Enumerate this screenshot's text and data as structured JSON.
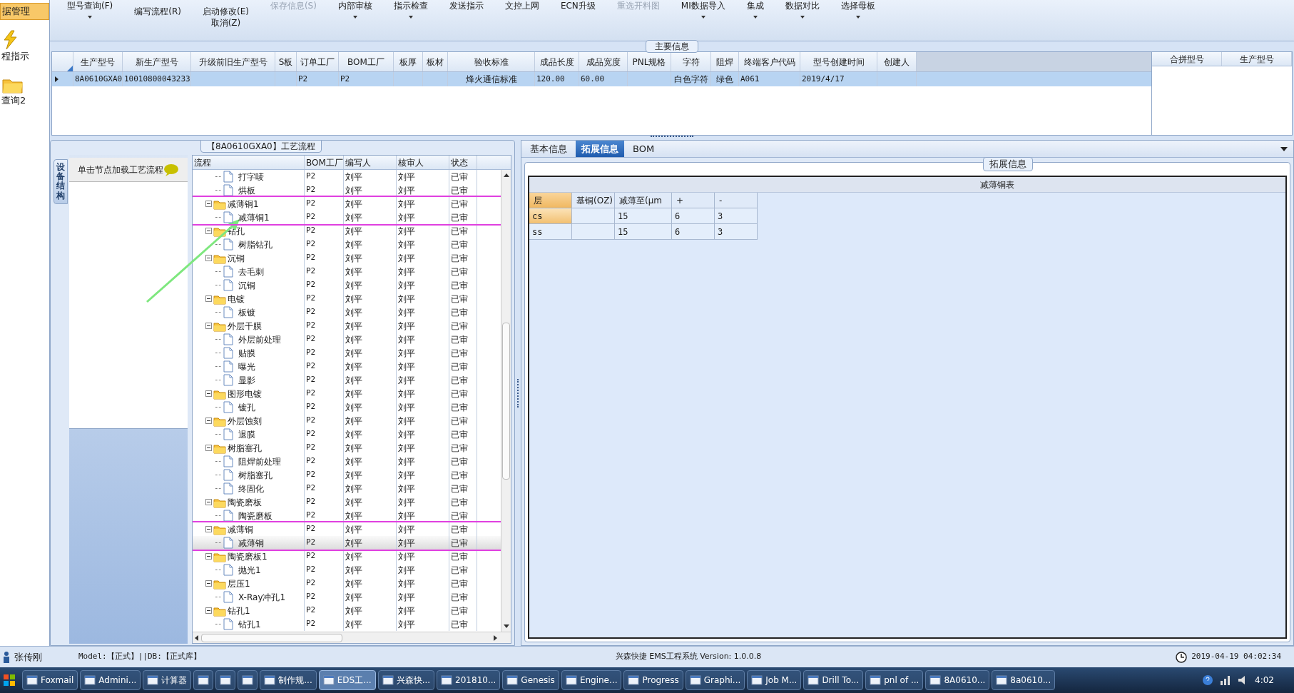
{
  "sidebar": {
    "items": [
      {
        "label": "据管理",
        "selected": true
      },
      {
        "label": "程指示",
        "selected": false
      },
      {
        "label": "查询2",
        "selected": false
      }
    ]
  },
  "toolbar": [
    {
      "lines": [
        "型号查询(F)"
      ],
      "disabled": false,
      "dropdown": true
    },
    {
      "lines": [
        "编写流程(R)"
      ],
      "disabled": false,
      "dropdown": false
    },
    {
      "lines": [
        "启动修改(E)",
        "取消(Z)"
      ],
      "disabled": false,
      "dropdown": false
    },
    {
      "lines": [
        "保存信息(S)"
      ],
      "disabled": true,
      "dropdown": false
    },
    {
      "lines": [
        "内部审核"
      ],
      "disabled": false,
      "dropdown": true
    },
    {
      "lines": [
        "指示检查"
      ],
      "disabled": false,
      "dropdown": true
    },
    {
      "lines": [
        "发送指示"
      ],
      "disabled": false,
      "dropdown": false
    },
    {
      "lines": [
        "文控上网"
      ],
      "disabled": false,
      "dropdown": false
    },
    {
      "lines": [
        "ECN升级"
      ],
      "disabled": false,
      "dropdown": false
    },
    {
      "lines": [
        "重选开料图"
      ],
      "disabled": true,
      "dropdown": false
    },
    {
      "lines": [
        "MI数据导入"
      ],
      "disabled": false,
      "dropdown": true
    },
    {
      "lines": [
        "集成"
      ],
      "disabled": false,
      "dropdown": true
    },
    {
      "lines": [
        "数据对比"
      ],
      "disabled": false,
      "dropdown": true
    },
    {
      "lines": [
        "选择母板"
      ],
      "disabled": false,
      "dropdown": true
    }
  ],
  "main_info": {
    "title": "主要信息",
    "columns": [
      "生产型号",
      "新生产型号",
      "升级前旧生产型号",
      "S板",
      "订单工厂",
      "BOM工厂",
      "板厚",
      "板材",
      "验收标准",
      "成品长度",
      "成品宽度",
      "PNL规格",
      "字符",
      "阻焊",
      "终端客户代码",
      "型号创建时间",
      "创建人"
    ],
    "rows": [
      {
        "selected": true,
        "cells": [
          "8A0610GXA0",
          "10010800043233",
          null,
          null,
          "P2",
          "P2",
          null,
          null,
          "烽火通信标准",
          "120.00",
          "60.00",
          null,
          "白色字符",
          "绿色",
          "A061",
          "2019/4/17",
          null
        ]
      }
    ],
    "side_columns": [
      "合拼型号",
      "生产型号"
    ]
  },
  "process": {
    "title": "【8A0610GXA0】工艺流程",
    "side_tab": "设备结构",
    "hint": "单击节点加载工艺流程",
    "columns": [
      "流程",
      "BOM工厂",
      "编写人",
      "核审人",
      "状态"
    ],
    "items": [
      {
        "kind": "file",
        "label": "打字唛",
        "cells": [
          "P2",
          "刘平",
          "刘平",
          "已审"
        ],
        "selected": false
      },
      {
        "kind": "file",
        "label": "烘板",
        "cells": [
          "P2",
          "刘平",
          "刘平",
          "已审"
        ],
        "selected": false
      },
      {
        "kind": "folder",
        "label": "减薄铜1",
        "cells": [
          "P2",
          "刘平",
          "刘平",
          "已审"
        ],
        "selected": false,
        "expanded": true,
        "highlighted": true,
        "children": [
          {
            "kind": "file",
            "label": "减薄铜1",
            "cells": [
              "P2",
              "刘平",
              "刘平",
              "已审"
            ],
            "selected": false
          }
        ]
      },
      {
        "kind": "folder",
        "label": "钻孔",
        "cells": [
          "P2",
          "刘平",
          "刘平",
          "已审"
        ],
        "selected": false,
        "expanded": true,
        "highlighted": false,
        "children": [
          {
            "kind": "file",
            "label": "树脂钻孔",
            "cells": [
              "P2",
              "刘平",
              "刘平",
              "已审"
            ],
            "selected": false
          }
        ]
      },
      {
        "kind": "folder",
        "label": "沉铜",
        "cells": [
          "P2",
          "刘平",
          "刘平",
          "已审"
        ],
        "selected": false,
        "expanded": true,
        "highlighted": false,
        "children": [
          {
            "kind": "file",
            "label": "去毛刺",
            "cells": [
              "P2",
              "刘平",
              "刘平",
              "已审"
            ],
            "selected": false
          },
          {
            "kind": "file",
            "label": "沉铜",
            "cells": [
              "P2",
              "刘平",
              "刘平",
              "已审"
            ],
            "selected": false
          }
        ]
      },
      {
        "kind": "folder",
        "label": "电镀",
        "cells": [
          "P2",
          "刘平",
          "刘平",
          "已审"
        ],
        "selected": false,
        "expanded": true,
        "highlighted": false,
        "children": [
          {
            "kind": "file",
            "label": "板镀",
            "cells": [
              "P2",
              "刘平",
              "刘平",
              "已审"
            ],
            "selected": false
          }
        ]
      },
      {
        "kind": "folder",
        "label": "外层干膜",
        "cells": [
          "P2",
          "刘平",
          "刘平",
          "已审"
        ],
        "selected": false,
        "expanded": true,
        "highlighted": false,
        "children": [
          {
            "kind": "file",
            "label": "外层前处理",
            "cells": [
              "P2",
              "刘平",
              "刘平",
              "已审"
            ],
            "selected": false
          },
          {
            "kind": "file",
            "label": "贴膜",
            "cells": [
              "P2",
              "刘平",
              "刘平",
              "已审"
            ],
            "selected": false
          },
          {
            "kind": "file",
            "label": "曝光",
            "cells": [
              "P2",
              "刘平",
              "刘平",
              "已审"
            ],
            "selected": false
          },
          {
            "kind": "file",
            "label": "显影",
            "cells": [
              "P2",
              "刘平",
              "刘平",
              "已审"
            ],
            "selected": false
          }
        ]
      },
      {
        "kind": "folder",
        "label": "图形电镀",
        "cells": [
          "P2",
          "刘平",
          "刘平",
          "已审"
        ],
        "selected": false,
        "expanded": true,
        "highlighted": false,
        "children": [
          {
            "kind": "file",
            "label": "镀孔",
            "cells": [
              "P2",
              "刘平",
              "刘平",
              "已审"
            ],
            "selected": false
          }
        ]
      },
      {
        "kind": "folder",
        "label": "外层蚀刻",
        "cells": [
          "P2",
          "刘平",
          "刘平",
          "已审"
        ],
        "selected": false,
        "expanded": true,
        "highlighted": false,
        "children": [
          {
            "kind": "file",
            "label": "退膜",
            "cells": [
              "P2",
              "刘平",
              "刘平",
              "已审"
            ],
            "selected": false
          }
        ]
      },
      {
        "kind": "folder",
        "label": "树脂塞孔",
        "cells": [
          "P2",
          "刘平",
          "刘平",
          "已审"
        ],
        "selected": false,
        "expanded": true,
        "highlighted": false,
        "children": [
          {
            "kind": "file",
            "label": "阻焊前处理",
            "cells": [
              "P2",
              "刘平",
              "刘平",
              "已审"
            ],
            "selected": false
          },
          {
            "kind": "file",
            "label": "树脂塞孔",
            "cells": [
              "P2",
              "刘平",
              "刘平",
              "已审"
            ],
            "selected": false
          },
          {
            "kind": "file",
            "label": "终固化",
            "cells": [
              "P2",
              "刘平",
              "刘平",
              "已审"
            ],
            "selected": false
          }
        ]
      },
      {
        "kind": "folder",
        "label": "陶瓷磨板",
        "cells": [
          "P2",
          "刘平",
          "刘平",
          "已审"
        ],
        "selected": false,
        "expanded": true,
        "highlighted": false,
        "children": [
          {
            "kind": "file",
            "label": "陶瓷磨板",
            "cells": [
              "P2",
              "刘平",
              "刘平",
              "已审"
            ],
            "selected": false
          }
        ]
      },
      {
        "kind": "folder",
        "label": "减薄铜",
        "cells": [
          "P2",
          "刘平",
          "刘平",
          "已审"
        ],
        "selected": false,
        "expanded": true,
        "highlighted": true,
        "children": [
          {
            "kind": "file",
            "label": "减薄铜",
            "cells": [
              "P2",
              "刘平",
              "刘平",
              "已审"
            ],
            "selected": true
          }
        ]
      },
      {
        "kind": "folder",
        "label": "陶瓷磨板1",
        "cells": [
          "P2",
          "刘平",
          "刘平",
          "已审"
        ],
        "selected": false,
        "expanded": true,
        "highlighted": false,
        "children": [
          {
            "kind": "file",
            "label": "抛光1",
            "cells": [
              "P2",
              "刘平",
              "刘平",
              "已审"
            ],
            "selected": false
          }
        ]
      },
      {
        "kind": "folder",
        "label": "层压1",
        "cells": [
          "P2",
          "刘平",
          "刘平",
          "已审"
        ],
        "selected": false,
        "expanded": true,
        "highlighted": false,
        "children": [
          {
            "kind": "file",
            "label": "X-Ray冲孔1",
            "cells": [
              "P2",
              "刘平",
              "刘平",
              "已审"
            ],
            "selected": false
          }
        ]
      },
      {
        "kind": "folder",
        "label": "钻孔1",
        "cells": [
          "P2",
          "刘平",
          "刘平",
          "已审"
        ],
        "selected": false,
        "expanded": true,
        "highlighted": false,
        "children": [
          {
            "kind": "file",
            "label": "钻孔1",
            "cells": [
              "P2",
              "刘平",
              "刘平",
              "已审"
            ],
            "selected": false
          }
        ]
      }
    ]
  },
  "detail": {
    "tabs": [
      {
        "label": "基本信息",
        "selected": false
      },
      {
        "label": "拓展信息",
        "selected": true
      },
      {
        "label": "BOM",
        "selected": false
      }
    ],
    "group_title": "拓展信息",
    "table_title": "减薄铜表",
    "columns": [
      "层",
      "基铜(OZ)",
      "减薄至(μm",
      "+",
      "-"
    ],
    "rows": [
      {
        "selected": true,
        "cells": [
          "cs",
          null,
          "15",
          "6",
          "3"
        ]
      },
      {
        "selected": false,
        "cells": [
          "ss",
          null,
          "15",
          "6",
          "3"
        ]
      }
    ]
  },
  "status_bar": {
    "user": "张传刚",
    "model": "Model:【正式】||DB:【正式库】",
    "product": "兴森快捷 EMS工程系统 Version: 1.0.0.8",
    "time": "2019-04-19 04:02:34"
  },
  "taskbar": {
    "items": [
      {
        "kind": "label",
        "label": "Foxmail",
        "selected": false
      },
      {
        "kind": "label",
        "label": "Admini...",
        "selected": false
      },
      {
        "kind": "label",
        "label": "计算器",
        "selected": false
      },
      {
        "kind": "icon",
        "selected": false
      },
      {
        "kind": "icon",
        "selected": false
      },
      {
        "kind": "icon",
        "selected": false
      },
      {
        "kind": "label",
        "label": "制作规...",
        "selected": false
      },
      {
        "kind": "label",
        "label": "EDS工...",
        "selected": true
      },
      {
        "kind": "label",
        "label": "兴森快...",
        "selected": false
      },
      {
        "kind": "label",
        "label": "201810...",
        "selected": false
      },
      {
        "kind": "label",
        "label": "Genesis",
        "selected": false
      },
      {
        "kind": "label",
        "label": "Engine...",
        "selected": false
      },
      {
        "kind": "label",
        "label": "Progress",
        "selected": false
      },
      {
        "kind": "label",
        "label": "Graphi...",
        "selected": false
      },
      {
        "kind": "label",
        "label": "Job M...",
        "selected": false
      },
      {
        "kind": "label",
        "label": "Drill To...",
        "selected": false
      },
      {
        "kind": "label",
        "label": "pnl of ...",
        "selected": false
      },
      {
        "kind": "label",
        "label": "8A0610...",
        "selected": false
      },
      {
        "kind": "label",
        "label": "8a0610...",
        "selected": false
      }
    ],
    "clock": "4:02"
  }
}
